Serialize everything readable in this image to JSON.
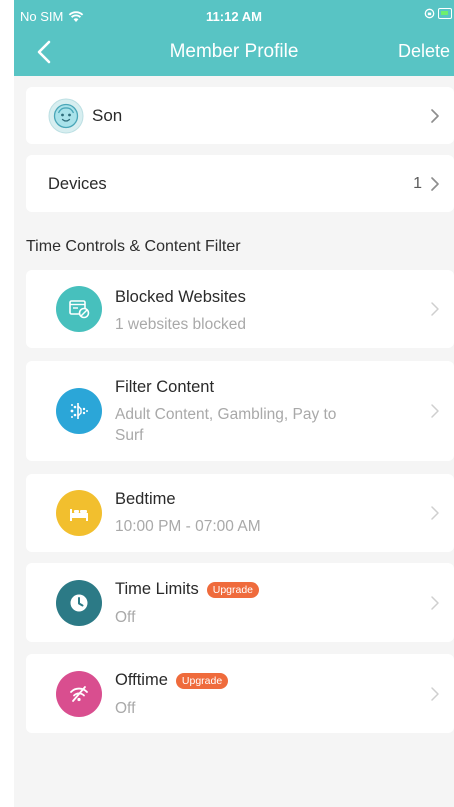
{
  "status": {
    "carrier": "No SIM",
    "time": "11:12 AM"
  },
  "nav": {
    "title": "Member Profile",
    "action": "Delete"
  },
  "profile": {
    "name": "Son"
  },
  "devices": {
    "label": "Devices",
    "count": "1"
  },
  "section_title": "Time Controls & Content Filter",
  "items": [
    {
      "title": "Blocked Websites",
      "subtitle": "1 websites blocked",
      "icon": "blocked-websites-icon",
      "color": "#47c0bd"
    },
    {
      "title": "Filter Content",
      "subtitle": "Adult Content, Gambling, Pay to Surf",
      "icon": "filter-content-icon",
      "color": "#2ba6d8"
    },
    {
      "title": "Bedtime",
      "subtitle": "10:00 PM - 07:00 AM",
      "icon": "bed-icon",
      "color": "#f2bf2e"
    },
    {
      "title": "Time Limits",
      "subtitle": "Off",
      "badge": "Upgrade",
      "icon": "clock-icon",
      "color": "#2c7a86"
    },
    {
      "title": "Offtime",
      "subtitle": "Off",
      "badge": "Upgrade",
      "icon": "wifi-off-icon",
      "color": "#d94e8f"
    }
  ],
  "colors": {
    "header": "#58c4c4",
    "badge": "#ef6b3c",
    "background": "#f5f5f5"
  }
}
